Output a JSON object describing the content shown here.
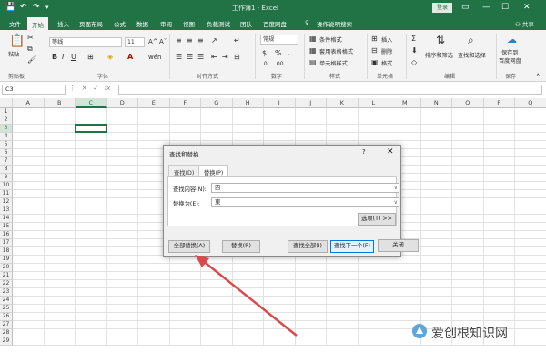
{
  "titlebar": {
    "title": "工作簿1 - Excel",
    "login": "登录",
    "colors": {
      "brand": "#217346"
    }
  },
  "tabs": {
    "items": [
      "文件",
      "开始",
      "插入",
      "页面布局",
      "公式",
      "数据",
      "审阅",
      "视图",
      "负载测试",
      "团队",
      "百度网盘"
    ],
    "tell_me": "操作说明搜索",
    "share": "共享"
  },
  "ribbon": {
    "clipboard": {
      "paste": "粘贴",
      "group": "剪贴板"
    },
    "font": {
      "name": "等线",
      "size": "11",
      "group": "字体",
      "bold": "B",
      "italic": "I",
      "underline": "U"
    },
    "alignment": {
      "group": "对齐方式"
    },
    "number": {
      "format": "常规",
      "group": "数字"
    },
    "styles": {
      "conditional": "条件格式",
      "table": "套用表格格式",
      "cell": "单元格样式",
      "group": "样式"
    },
    "cells": {
      "insert": "插入",
      "delete": "删除",
      "format": "格式",
      "group": "单元格"
    },
    "editing": {
      "sort": "排序和筛选",
      "find": "查找和选择",
      "group": "编辑"
    },
    "save": {
      "label1": "保存到",
      "label2": "百度网盘",
      "group": "保存"
    }
  },
  "formula_bar": {
    "name_box": "C3",
    "fx": "fx"
  },
  "grid": {
    "columns": [
      "A",
      "B",
      "C",
      "D",
      "E",
      "F",
      "G",
      "H",
      "I",
      "J",
      "K",
      "L",
      "M",
      "N",
      "O",
      "P",
      "Q"
    ],
    "rows": [
      "1",
      "2",
      "3",
      "4",
      "5",
      "6",
      "7",
      "8",
      "9",
      "10",
      "11",
      "12",
      "13",
      "14",
      "15",
      "16",
      "17",
      "18",
      "19",
      "20",
      "21",
      "22",
      "23",
      "24",
      "25",
      "26",
      "27",
      "28",
      "29"
    ],
    "selected_cell": "C3"
  },
  "dialog": {
    "title": "查找和替换",
    "help": "?",
    "tabs": [
      "查找(D)",
      "替换(P)"
    ],
    "find_label": "查找内容(N):",
    "find_value": "西",
    "replace_label": "替换为(E):",
    "replace_value": "東",
    "options_button": "选项(T) >>",
    "buttons": [
      "全部替换(A)",
      "替换(R)",
      "查找全部(I)",
      "查找下一个(F)",
      "关闭"
    ]
  },
  "annotation": {
    "arrow_color": "#d94a4a"
  },
  "watermark": "爱创根知识网"
}
